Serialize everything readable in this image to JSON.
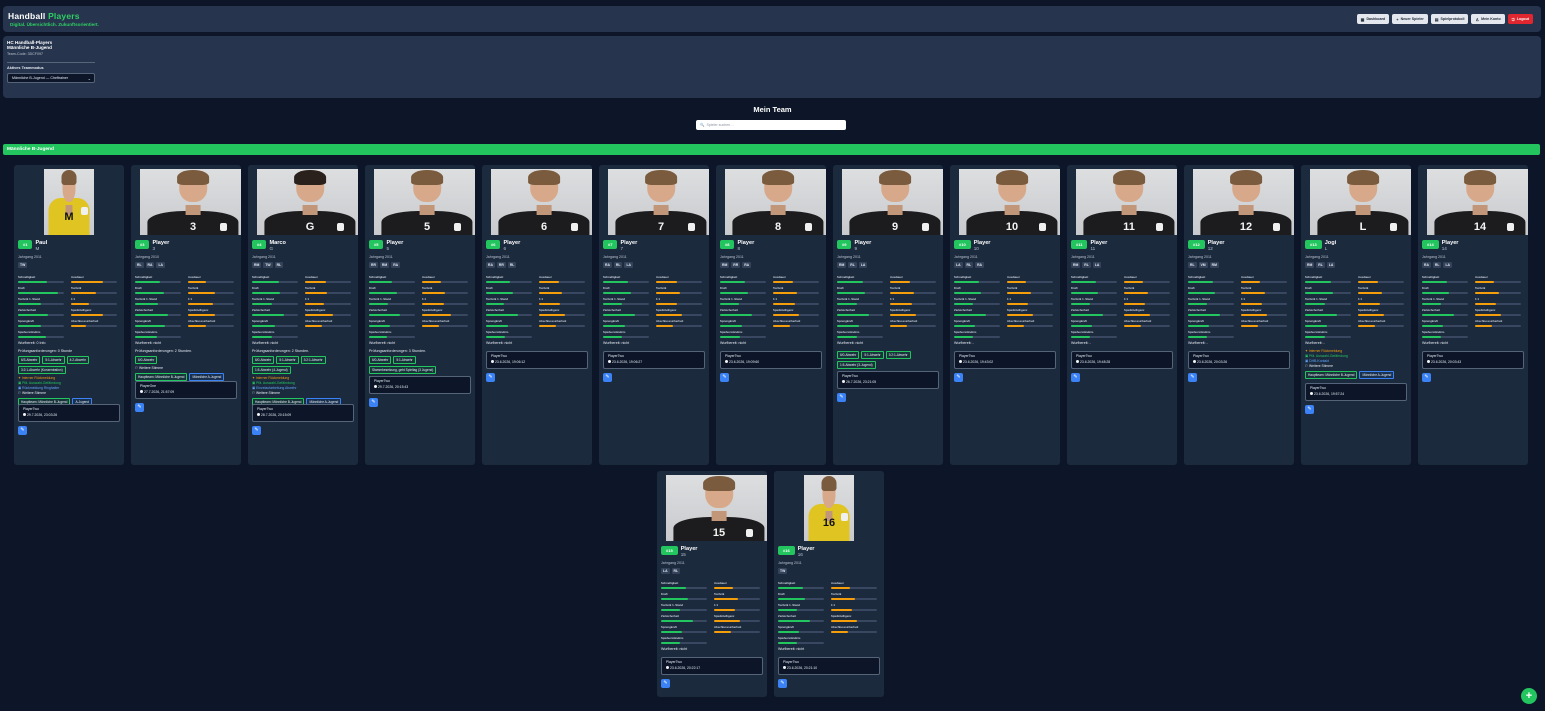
{
  "app": {
    "brand_main": "Handball",
    "brand_accent": "Players",
    "tagline": "Digital. Übersichtlich. Zukunftsorientiert.",
    "nav": [
      {
        "icon": "dashboard-icon",
        "label": "Dashboard"
      },
      {
        "icon": "plus-icon",
        "label": "Neuer Spieler"
      },
      {
        "icon": "clipboard-icon",
        "label": "Spielprotokoll"
      },
      {
        "icon": "user-icon",
        "label": "Mein Konto"
      },
      {
        "icon": "logout-icon",
        "label": "Logout"
      }
    ]
  },
  "club": {
    "name": "HC Handball-Players",
    "team": "Männliche B-Jugend",
    "team_code": "Team-Code: 3DCF097",
    "select_label": "Aktives Teammodus",
    "select_value": "Männliche B-Jugend — Cheftrainer"
  },
  "page": {
    "title": "Mein Team",
    "search_placeholder": "Spieler suchen…",
    "group": "Männliche B-Jugend"
  },
  "stat_labels": [
    "Schnelligkeit",
    "Ausdauer",
    "Kraft",
    "Technik",
    "Technik 1. Stand",
    "1:1",
    "Zielsicherheit",
    "Spielintelligenz",
    "Sprungkraft",
    "Abschlusssicherheit",
    "Spielverständnis"
  ],
  "colors": {
    "accent": "#22c55e",
    "warning": "#f59e0b",
    "info": "#3b82f6",
    "danger": "#e0262e"
  },
  "players": [
    {
      "num": "#1",
      "name": "Paul",
      "pos_short": "M",
      "jahrgang": "Jahrgang 2011",
      "positions": [
        "TW"
      ],
      "stats": [
        62,
        70,
        88,
        55,
        50,
        40,
        66,
        70,
        50,
        32,
        60
      ],
      "mode": "Wurfbereit: 0 Info",
      "extra_title": "Prüfungsanforderungen: 0 Stunde",
      "badges": [
        [
          "6/3-Abwehr",
          "g"
        ],
        [
          "5:1-Abwehr",
          "g"
        ],
        [
          "4:2-Abwehr",
          "g"
        ],
        [
          "3:2:1-Abwehr (Konzentration)",
          "g"
        ]
      ],
      "notes": [
        [
          "✦ Interner Rückmeldung",
          "orange"
        ],
        [
          "▣ Pfä. Auswahl-Gefährdung",
          "green"
        ],
        [
          "▣ Rückmeldung Ringhalter",
          "blue"
        ],
        [
          "⚐ Weitere Stimme",
          "white"
        ]
      ],
      "badges2": [
        [
          "Hauptteam: Männliche B-Jugend",
          "g"
        ],
        [
          "A-Jugend",
          "blue"
        ]
      ],
      "watched_by": "PlayerTwo",
      "watched_date": "29.7.2026, 23:03:26"
    },
    {
      "num": "#3",
      "name": "Player",
      "pos_short": "3",
      "jahrgang": "Jahrgang 2010",
      "positions": [
        "RL",
        "RA",
        "LA"
      ],
      "stats": [
        55,
        40,
        62,
        58,
        50,
        55,
        72,
        58,
        66,
        40,
        48
      ],
      "mode": "Wurfbereit: nicht",
      "extra_title": "Prüfungsanforderungen: 2 Stunden.",
      "badges": [
        [
          "6/0-Abwehr",
          "g"
        ]
      ],
      "notes": [
        [
          "⚐ Weitere Stimme",
          "white"
        ]
      ],
      "badges2": [
        [
          "Hauptteam: Männliche B-Jugend",
          "g"
        ],
        [
          "Männliche A-Jugend",
          "blue"
        ]
      ],
      "watched_by": "PlayerOne",
      "watched_date": "27.7.2026, 21:57:09"
    },
    {
      "num": "#4",
      "name": "Marco",
      "pos_short": "G",
      "jahrgang": "Jahrgang 2011",
      "positions": [
        "RM",
        "TW",
        "RL"
      ],
      "stats": [
        58,
        46,
        60,
        48,
        44,
        42,
        70,
        60,
        50,
        38,
        44
      ],
      "mode": "Wurfbereit: nicht",
      "extra_title": "Prüfungsanforderungen: 2 Stunden.",
      "badges": [
        [
          "6/0-Abwehr",
          "g"
        ],
        [
          "5:1-Abwehr",
          "g"
        ],
        [
          "3:2:1-Abwehr",
          "g"
        ],
        [
          "1:5-Abwehr (4-Jugend)",
          "g"
        ]
      ],
      "notes": [
        [
          "✦ Interner Rückmeldung",
          "orange"
        ],
        [
          "▣ Pfä. Auswahl-Gefährdung",
          "green"
        ],
        [
          "▣ Einzelaufarbeitung Abwehr",
          "blue"
        ],
        [
          "⚐ Weitere Stimme",
          "white"
        ]
      ],
      "badges2": [
        [
          "Hauptteam: Männliche B-Jugend",
          "g"
        ],
        [
          "Männliche A-Jugend",
          "blue"
        ]
      ],
      "watched_by": "PlayerTwo",
      "watched_date": "28.7.2026, 20:15:09"
    },
    {
      "num": "#5",
      "name": "Player",
      "pos_short": "5",
      "jahrgang": "Jahrgang 2011",
      "positions": [
        "RR",
        "RM",
        "RA"
      ],
      "stats": [
        50,
        42,
        60,
        50,
        42,
        48,
        68,
        62,
        46,
        38,
        40
      ],
      "mode": "Wurfbereit: nicht",
      "extra_title": "Prüfungsanforderungen: 3 Stunden.",
      "badges": [
        [
          "6/0-Abwehr",
          "g"
        ],
        [
          "5:1-Abwehr",
          "g"
        ],
        [
          "Stammbesetzung, geht Spieltag (3 Jugend)",
          "g"
        ],
        [
          "1:5-Abwehr (3-Jugend)",
          "g"
        ]
      ],
      "notes": [],
      "badges2": [],
      "watched_by": "PlayerTwo",
      "watched_date": "29.7.2026, 20:15:43"
    },
    {
      "num": "#6",
      "name": "Player",
      "pos_short": "6",
      "jahrgang": "Jahrgang 2011",
      "positions": [
        "RA",
        "RR",
        "RL"
      ],
      "stats": [
        52,
        44,
        58,
        50,
        40,
        46,
        70,
        56,
        48,
        36,
        42
      ],
      "mode": "Wurfbereit: nicht",
      "extra_title": "",
      "badges": [],
      "notes": [],
      "badges2": [],
      "watched_by": "PlayerTwo",
      "watched_date": "23.6.2026, 19:06:12"
    },
    {
      "num": "#7",
      "name": "Player",
      "pos_short": "7",
      "jahrgang": "Jahrgang 2011",
      "positions": [
        "RA",
        "RL",
        "LA"
      ],
      "stats": [
        54,
        45,
        60,
        52,
        42,
        46,
        70,
        56,
        48,
        36,
        42
      ],
      "mode": "Wurfbereit: nicht",
      "extra_title": "",
      "badges": [],
      "notes": [],
      "badges2": [],
      "watched_by": "PlayerTwo",
      "watched_date": "23.6.2026, 19:06:27"
    },
    {
      "num": "#8",
      "name": "Player",
      "pos_short": "8",
      "jahrgang": "Jahrgang 2011",
      "positions": [
        "RM",
        "RR",
        "RA"
      ],
      "stats": [
        54,
        44,
        60,
        52,
        42,
        48,
        70,
        56,
        48,
        36,
        44
      ],
      "mode": "Wurfbereit: nicht",
      "extra_title": "",
      "badges": [],
      "notes": [],
      "badges2": [],
      "watched_by": "PlayerTwo",
      "watched_date": "23.6.2026, 19:09:60"
    },
    {
      "num": "#9",
      "name": "Player",
      "pos_short": "9",
      "jahrgang": "Jahrgang 2011",
      "positions": [
        "RM",
        "RL",
        "LA"
      ],
      "stats": [
        56,
        44,
        60,
        52,
        44,
        48,
        70,
        56,
        48,
        38,
        44
      ],
      "mode": "Wurfbereit: nicht",
      "extra_title": "",
      "badges": [
        [
          "6/0-Abwehr",
          "g"
        ],
        [
          "5:1-Abwehr",
          "g"
        ],
        [
          "3:2:1-Abwehr",
          "g"
        ],
        [
          "1:5-Abwehr (3-Jugend)",
          "g"
        ]
      ],
      "notes": [],
      "badges2": [],
      "watched_by": "PlayerTwo",
      "watched_date": "26.7.2026, 23:21:05"
    },
    {
      "num": "#10",
      "name": "Player",
      "pos_short": "10",
      "jahrgang": "Jahrgang 2011",
      "positions": [
        "LA",
        "RL",
        "RA"
      ],
      "stats": [
        54,
        42,
        58,
        52,
        42,
        46,
        70,
        56,
        46,
        36,
        42
      ],
      "mode": "Wurfbereit: -",
      "extra_title": "",
      "badges": [],
      "notes": [],
      "badges2": [],
      "watched_by": "PlayerTwo",
      "watched_date": "23.6.2026, 19:43:02"
    },
    {
      "num": "#11",
      "name": "Player",
      "pos_short": "11",
      "jahrgang": "Jahrgang 2011",
      "positions": [
        "RM",
        "RL",
        "LA"
      ],
      "stats": [
        54,
        42,
        58,
        52,
        42,
        46,
        70,
        56,
        46,
        36,
        42
      ],
      "mode": "Wurfbereit: -",
      "extra_title": "",
      "badges": [],
      "notes": [],
      "badges2": [],
      "watched_by": "PlayerTwo",
      "watched_date": "23.6.2026, 19:48:28"
    },
    {
      "num": "#12",
      "name": "Player",
      "pos_short": "12",
      "jahrgang": "Jahrgang 2011",
      "positions": [
        "RL",
        "VM",
        "RM"
      ],
      "stats": [
        54,
        42,
        58,
        52,
        42,
        46,
        70,
        56,
        46,
        36,
        42
      ],
      "mode": "Wurfbereit: -",
      "extra_title": "",
      "badges": [],
      "notes": [],
      "badges2": [],
      "watched_by": "PlayerTwo",
      "watched_date": "23.6.2026, 20:03:26"
    },
    {
      "num": "#13",
      "name": "Jogi",
      "pos_short": "L",
      "jahrgang": "Jahrgang 2011",
      "positions": [
        "RM",
        "RL",
        "LA"
      ],
      "stats": [
        56,
        44,
        60,
        52,
        44,
        48,
        70,
        56,
        48,
        38,
        44
      ],
      "mode": "Wurfbereit: -",
      "extra_title": "",
      "badges": [],
      "notes": [
        [
          "✦ Interner Rückmeldung",
          "orange"
        ],
        [
          "▣ Pfä. Auswahl-Gefährdung",
          "green"
        ],
        [
          "▣ DHB-Kontakt",
          "blue"
        ],
        [
          "⚐ Weitere Stimme",
          "white"
        ]
      ],
      "badges2": [
        [
          "Hauptteam: Männliche B-Jugend",
          "g"
        ],
        [
          "Männliche A-Jugend",
          "blue"
        ]
      ],
      "watched_by": "PlayerTwo",
      "watched_date": "23.6.2026, 19:57:24"
    },
    {
      "num": "#14",
      "name": "Player",
      "pos_short": "14",
      "jahrgang": "Jahrgang 2011",
      "positions": [
        "RA",
        "RL",
        "LA"
      ],
      "stats": [
        54,
        42,
        58,
        52,
        42,
        46,
        70,
        56,
        46,
        36,
        42
      ],
      "mode": "Wurfbereit: nicht",
      "extra_title": "",
      "badges": [],
      "notes": [],
      "badges2": [],
      "watched_by": "PlayerTwo",
      "watched_date": "23.6.2026, 20:03:43"
    },
    {
      "num": "#15",
      "name": "Player",
      "pos_short": "15",
      "jahrgang": "Jahrgang 2011",
      "positions": [
        "LA",
        "RL"
      ],
      "stats": [
        54,
        42,
        58,
        52,
        42,
        46,
        70,
        56,
        46,
        36,
        42
      ],
      "mode": "Wurfbereit: nicht",
      "extra_title": "",
      "badges": [],
      "notes": [],
      "badges2": [],
      "watched_by": "PlayerTwo",
      "watched_date": "23.6.2026, 20:22:17"
    },
    {
      "num": "#16",
      "name": "Player",
      "pos_short": "16",
      "jahrgang": "Jahrgang 2011",
      "positions": [
        "TW"
      ],
      "stats": [
        54,
        42,
        58,
        52,
        42,
        46,
        70,
        56,
        46,
        36,
        42
      ],
      "mode": "Wurfbereit: nicht",
      "extra_title": "",
      "badges": [],
      "notes": [],
      "badges2": [],
      "watched_by": "PlayerTwo",
      "watched_date": "23.6.2026, 20:21:10"
    }
  ],
  "fab_label": "+"
}
